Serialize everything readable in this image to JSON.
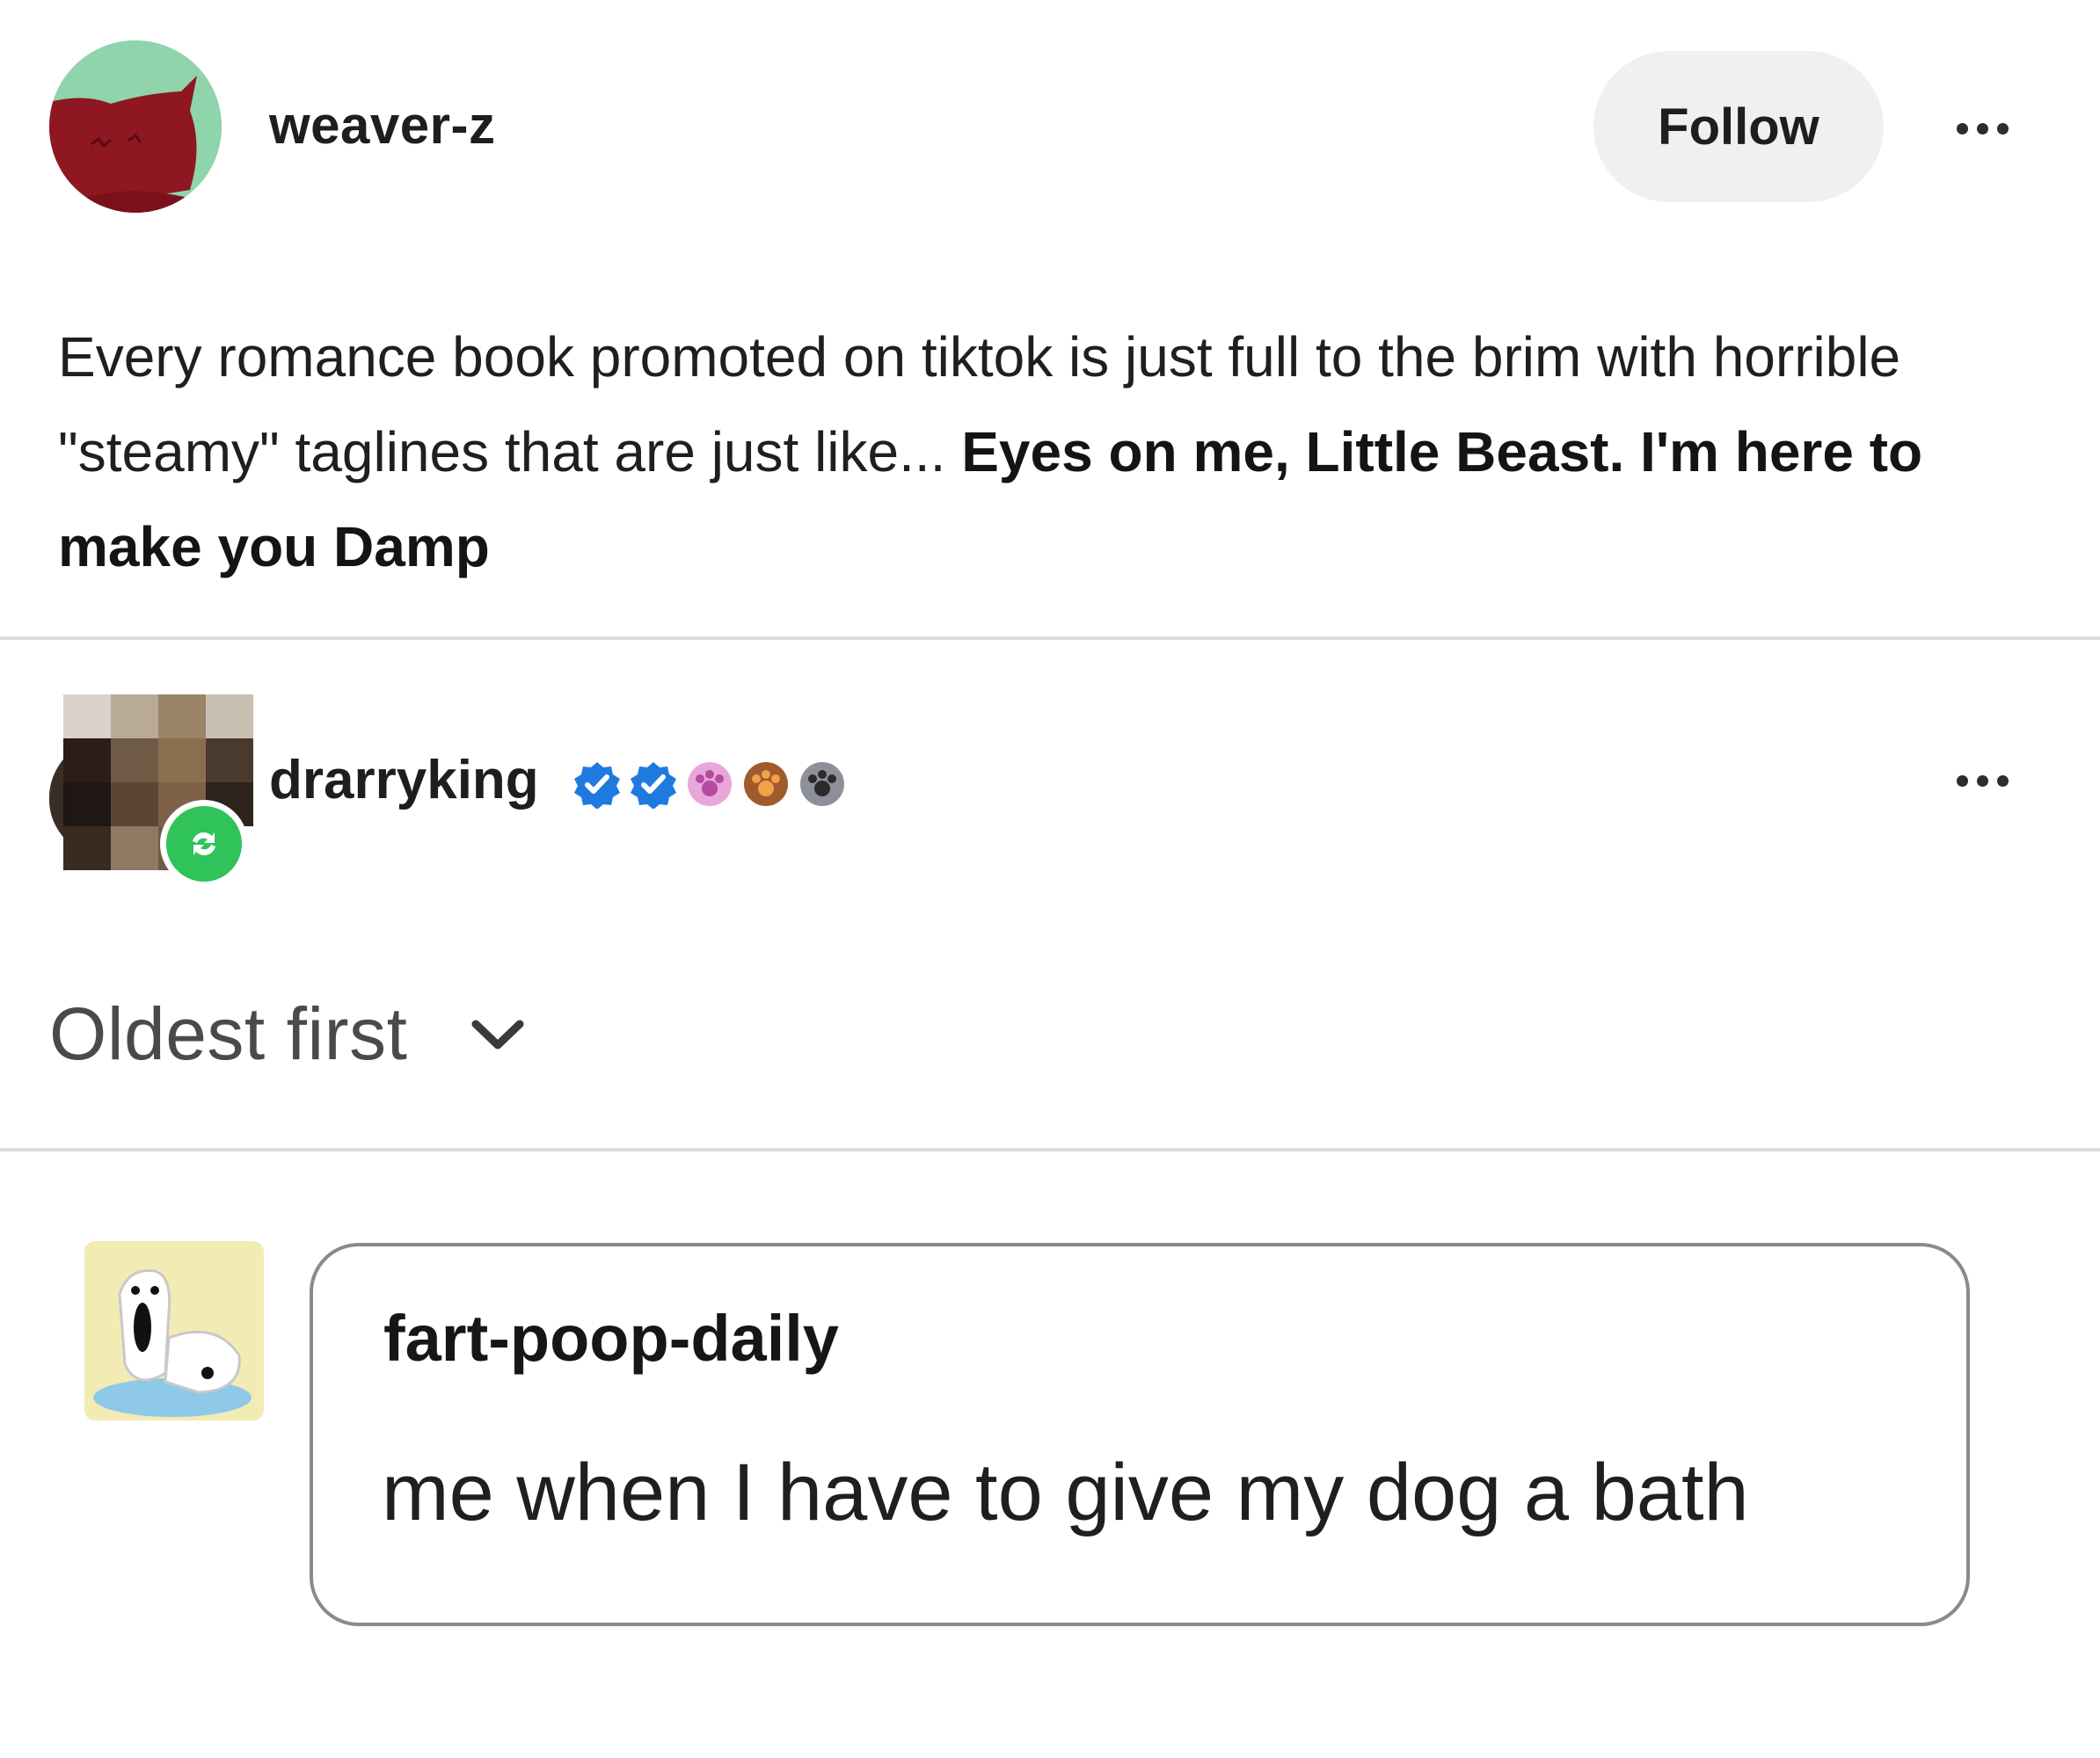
{
  "post": {
    "author": "weaver-z",
    "follow_label": "Follow",
    "body": {
      "plain": "Every romance book promoted on tiktok is just full to the brim with horrible \"steamy\" taglines that are just like... ",
      "bold": "Eyes on me, Little Beast. I'm here to make you Damp"
    },
    "avatar_colors": {
      "background": "#8fd4ab",
      "head": "#8f1721"
    }
  },
  "reblog": {
    "author": "drarryking",
    "badge_icons": [
      "verified-check-icon",
      "verified-check-icon",
      "pink-paw-icon",
      "brown-paw-icon",
      "grey-paw-icon"
    ],
    "badge_color": "#2fc35a"
  },
  "replies": {
    "sort_label": "Oldest first",
    "items": [
      {
        "author": "fart-poop-daily",
        "text": "me when I have to give my dog a bath"
      }
    ]
  }
}
